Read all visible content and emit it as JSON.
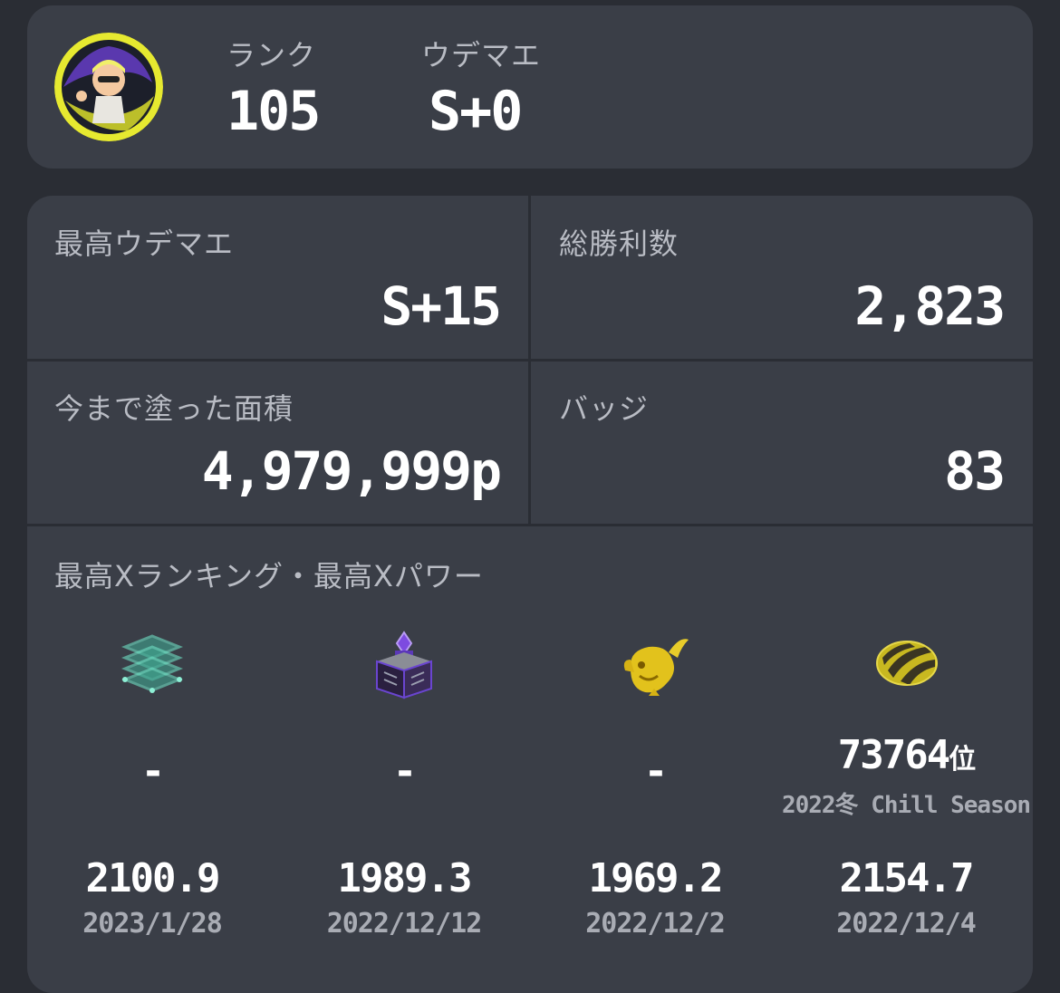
{
  "profile": {
    "rank_label": "ランク",
    "rank_value": "105",
    "udemae_label": "ウデマエ",
    "udemae_value": "S+0"
  },
  "stats": {
    "max_udemae_label": "最高ウデマエ",
    "max_udemae_value": "S+15",
    "total_wins_label": "総勝利数",
    "total_wins_value": "2,823",
    "painted_area_label": "今まで塗った面積",
    "painted_area_value": "4,979,999p",
    "badges_label": "バッジ",
    "badges_value": "83"
  },
  "x_ranking": {
    "section_label": "最高Xランキング・最高Xパワー",
    "modes": [
      {
        "icon": "splat-zones-icon",
        "rank": "-",
        "season": "",
        "power": "2100.9",
        "date": "2023/1/28"
      },
      {
        "icon": "tower-control-icon",
        "rank": "-",
        "season": "",
        "power": "1989.3",
        "date": "2022/12/12"
      },
      {
        "icon": "rainmaker-icon",
        "rank": "-",
        "season": "",
        "power": "1969.2",
        "date": "2022/12/2"
      },
      {
        "icon": "clam-blitz-icon",
        "rank": "73764",
        "rank_suffix": "位",
        "season": "2022冬 Chill Season",
        "power": "2154.7",
        "date": "2022/12/4"
      }
    ]
  },
  "colors": {
    "background": "#2a2d34",
    "card": "#3a3e47",
    "label": "#b9bcc4",
    "accent_yellow": "#e9e12a"
  }
}
